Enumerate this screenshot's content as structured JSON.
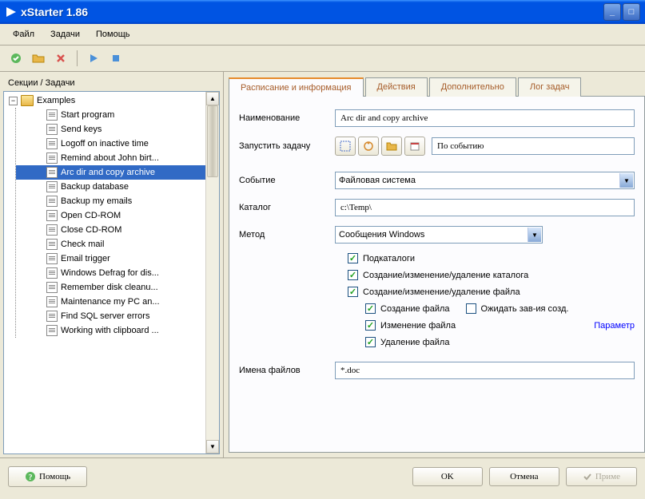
{
  "window": {
    "title": "xStarter 1.86"
  },
  "menubar": {
    "file": "Файл",
    "tasks": "Задачи",
    "help": "Помощь"
  },
  "leftPanel": {
    "header": "Секции / Задачи",
    "rootFolder": "Examples",
    "items": [
      "Start program",
      "Send keys",
      "Logoff on inactive time",
      "Remind about John birt...",
      "Arc dir and copy archive",
      "Backup database",
      "Backup my emails",
      "Open CD-ROM",
      "Close CD-ROM",
      "Check mail",
      "Email trigger",
      "Windows Defrag for dis...",
      "Remember disk cleanu...",
      "Maintenance my PC an...",
      "Find SQL server errors",
      "Working with clipboard ..."
    ],
    "selectedIndex": 4
  },
  "tabs": {
    "schedule": "Расписание и информация",
    "actions": "Действия",
    "additional": "Дополнительно",
    "log": "Лог задач"
  },
  "form": {
    "nameLabel": "Наименование",
    "nameValue": "Arc dir and copy archive",
    "runTaskLabel": "Запустить задачу",
    "runTaskValue": "По событию",
    "eventLabel": "Событие",
    "eventValue": "Файловая система",
    "catalogLabel": "Каталог",
    "catalogValue": "c:\\Temp\\",
    "methodLabel": "Метод",
    "methodValue": "Сообщения Windows",
    "checkboxes": {
      "subdirs": "Подкаталоги",
      "dirCrud": "Создание/изменение/удаление каталога",
      "fileCrud": "Создание/изменение/удаление файла",
      "fileCreate": "Создание файла",
      "fileModify": "Изменение файла",
      "fileDelete": "Удаление файла",
      "waitCreate": "Ожидать зав-ия созд."
    },
    "paramsLink": "Параметр",
    "filenamesLabel": "Имена файлов",
    "filenamesValue": "*.doc"
  },
  "buttons": {
    "help": "Помощь",
    "ok": "OK",
    "cancel": "Отмена",
    "apply": "Приме"
  }
}
